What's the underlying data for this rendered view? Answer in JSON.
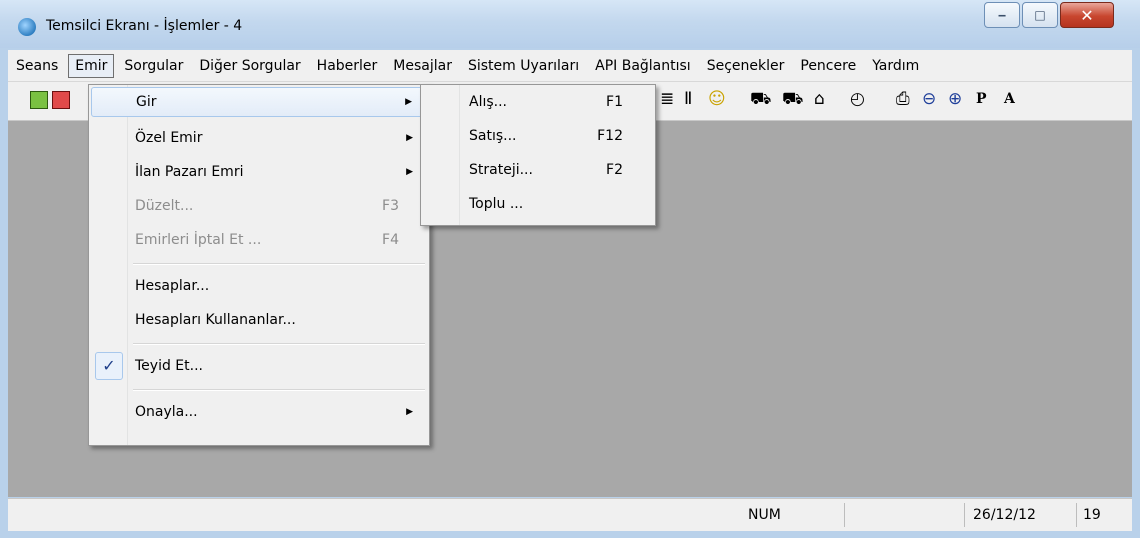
{
  "window": {
    "title": "Temsilci Ekranı - İşlemler - 4",
    "minimize_glyph": "‒",
    "maximize_glyph": "□",
    "close_glyph": "✕"
  },
  "menubar": {
    "items": [
      {
        "label": "Seans"
      },
      {
        "label": "Emir"
      },
      {
        "label": "Sorgular"
      },
      {
        "label": "Diğer Sorgular"
      },
      {
        "label": "Haberler"
      },
      {
        "label": "Mesajlar"
      },
      {
        "label": "Sistem Uyarıları"
      },
      {
        "label": "API Bağlantısı"
      },
      {
        "label": "Seçenekler"
      },
      {
        "label": "Pencere"
      },
      {
        "label": "Yardım"
      }
    ],
    "active_item": "Emir"
  },
  "toolbar": {
    "icons": [
      "new-green-icon",
      "new-red-icon",
      "list-icon",
      "chart-bar-icon",
      "smiley-icon",
      "chart-up-icon",
      "chart-down-icon",
      "inbox-icon",
      "clock-icon",
      "print-icon",
      "zoom-out-icon",
      "zoom-in-icon",
      "font-p-icon",
      "font-a-icon"
    ],
    "glyphs": {
      "list": "≣",
      "chart": "Ⅱ",
      "smiley": "☺",
      "up": "⛟",
      "down": "⛟",
      "inbox": "⌂",
      "clock": "◴",
      "print": "⎙",
      "zoom_out": "⊖",
      "zoom_in": "⊕",
      "p": "P",
      "a": "A"
    }
  },
  "emir_menu": {
    "items": [
      {
        "label": "Gir",
        "shortcut": "",
        "submenu": true,
        "disabled": false,
        "highlighted": true
      },
      {
        "label": "Özel Emir",
        "shortcut": "",
        "submenu": true,
        "disabled": false
      },
      {
        "label": "İlan Pazarı Emri",
        "shortcut": "",
        "submenu": true,
        "disabled": false
      },
      {
        "label": "Düzelt...",
        "shortcut": "F3",
        "submenu": false,
        "disabled": true
      },
      {
        "label": "Emirleri İptal Et ...",
        "shortcut": "F4",
        "submenu": false,
        "disabled": true
      },
      {
        "label": "Hesaplar...",
        "shortcut": "",
        "submenu": false,
        "disabled": false
      },
      {
        "label": "Hesapları Kullananlar...",
        "shortcut": "",
        "submenu": false,
        "disabled": false
      },
      {
        "label": "Teyid Et...",
        "shortcut": "",
        "submenu": false,
        "disabled": false,
        "checked": true
      },
      {
        "label": "Onayla...",
        "shortcut": "",
        "submenu": true,
        "disabled": false
      }
    ],
    "arrow_glyph": "▶",
    "check_glyph": "✓"
  },
  "gir_submenu": {
    "items": [
      {
        "label": "Alış...",
        "shortcut": "F1"
      },
      {
        "label": "Satış...",
        "shortcut": "F12"
      },
      {
        "label": "Strateji...",
        "shortcut": "F2"
      },
      {
        "label": "Toplu ...",
        "shortcut": ""
      }
    ]
  },
  "statusbar": {
    "num": "NUM",
    "date": "26/12/12",
    "page": "19"
  }
}
